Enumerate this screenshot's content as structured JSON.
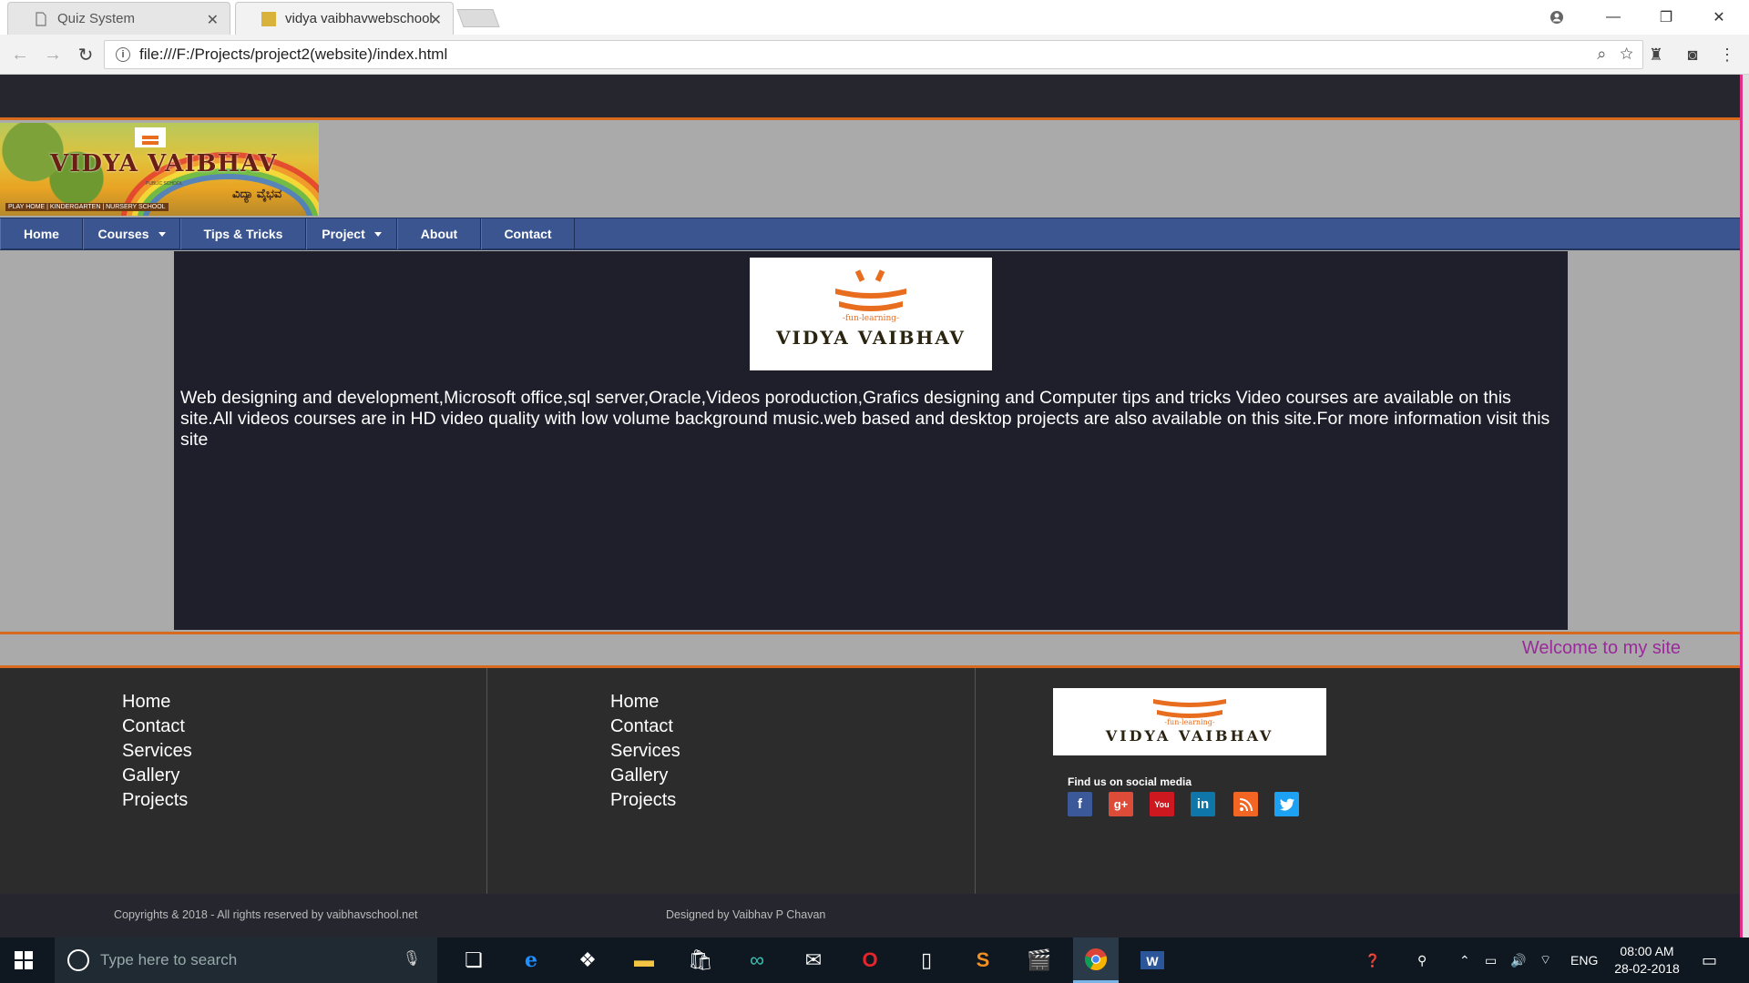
{
  "browser": {
    "tabs": [
      {
        "title": "Quiz System",
        "active": false
      },
      {
        "title": "vidya vaibhavwebschool",
        "active": true
      }
    ],
    "address": "file:///F:/Projects/project2(website)/index.html"
  },
  "site": {
    "banner": {
      "title": "VIDYA VAIBHAV",
      "subtitle": "PUBLIC SCHOOL",
      "kannada": "ವಿದ್ಯಾ ವೈಭವ",
      "bottom": "PLAY HOME | KINDERGARTEN | NURSERY SCHOOL"
    },
    "menu": [
      {
        "label": "Home",
        "dropdown": false
      },
      {
        "label": "Courses",
        "dropdown": true
      },
      {
        "label": "Tips & Tricks",
        "dropdown": false
      },
      {
        "label": "Project",
        "dropdown": true
      },
      {
        "label": "About",
        "dropdown": false
      },
      {
        "label": "Contact",
        "dropdown": false
      }
    ],
    "logo": {
      "tagline": "-fun-learning-",
      "name": "VIDYA VAIBHAV"
    },
    "intro": "Web designing and development,Microsoft office,sql server,Oracle,Videos poroduction,Grafics designing and Computer tips and tricks Video courses are available on this site.All videos courses are in HD video quality with low volume background music.web based and desktop projects are also available on this site.For more information visit this site",
    "welcome": "Welcome to my site",
    "footer": {
      "links_col1": [
        "Home",
        "Contact",
        "Services",
        "Gallery",
        "Projects"
      ],
      "links_col2": [
        "Home",
        "Contact",
        "Services",
        "Gallery",
        "Projects"
      ],
      "social_label": "Find us on social media",
      "social": [
        {
          "name": "facebook",
          "glyph": "f",
          "color": "#3b5998"
        },
        {
          "name": "google-plus",
          "glyph": "g+",
          "color": "#dd4b39"
        },
        {
          "name": "youtube",
          "glyph": "You",
          "color": "#cc181e"
        },
        {
          "name": "linkedin",
          "glyph": "in",
          "color": "#0e76a8"
        },
        {
          "name": "rss",
          "glyph": ")",
          "color": "#f26522"
        },
        {
          "name": "twitter",
          "glyph": "t",
          "color": "#1da1f2"
        }
      ],
      "copyright": "Copyrights & 2018 - All rights reserved by vaibhavschool.net",
      "designer": "Designed by Vaibhav P Chavan"
    }
  },
  "taskbar": {
    "search_placeholder": "Type here to search",
    "lang": "ENG",
    "time": "08:00 AM",
    "date": "28-02-2018"
  },
  "colors": {
    "accent_orange": "#d86a1e",
    "menu_blue": "#3b5591",
    "welcome_purple": "#9a2a9a"
  }
}
